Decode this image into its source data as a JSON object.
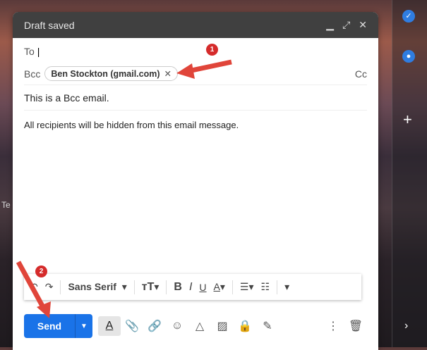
{
  "background_text": "Te",
  "compose": {
    "title": "Draft saved",
    "to_label": "To",
    "bcc_label": "Bcc",
    "cc_label": "Cc",
    "bcc_recipients": [
      "Ben Stockton (gmail.com)"
    ],
    "subject": "This is a Bcc email.",
    "body": "All recipients will be hidden from this email message."
  },
  "format_toolbar": {
    "font": "Sans Serif"
  },
  "send_label": "Send",
  "annotations": [
    "1",
    "2"
  ],
  "accent_color": "#1a73e8",
  "annotation_color": "#e0453a"
}
